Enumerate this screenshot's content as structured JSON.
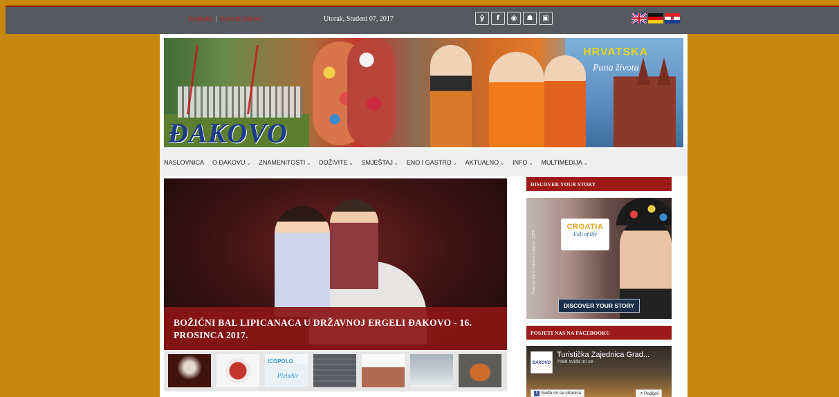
{
  "topbar": {
    "link_contact": "Kontakti",
    "separator": "|",
    "link_useful": "Korisni linkovi",
    "date": "Utorak, Studeni 07, 2017",
    "social_icons": [
      "twitter-icon",
      "facebook-icon",
      "pinterest-icon",
      "youtube-icon",
      "instagram-icon"
    ],
    "social_glyphs": [
      "ẏ",
      "f",
      "◉",
      "☗",
      "▣"
    ],
    "flags": [
      "uk-flag",
      "de-flag",
      "hr-flag"
    ]
  },
  "banner": {
    "logo_text": "ĐAKOVO",
    "tourism_text": "HRVATSKA",
    "tourism_slogan": "Puna života"
  },
  "nav": {
    "items": [
      {
        "label": "NASLOVNICA",
        "dropdown": false
      },
      {
        "label": "O ĐAKOVU",
        "dropdown": true
      },
      {
        "label": "ZNAMENITOSTI",
        "dropdown": true
      },
      {
        "label": "DOŽIVITE",
        "dropdown": true
      },
      {
        "label": "SMJEŠTAJ",
        "dropdown": true
      },
      {
        "label": "ENO I GASTRO",
        "dropdown": true
      },
      {
        "label": "AKTUALNO",
        "dropdown": true
      },
      {
        "label": "INFO",
        "dropdown": true
      },
      {
        "label": "MULTIMEDIJA",
        "dropdown": true
      }
    ],
    "chevron": "⌄"
  },
  "hero": {
    "caption": "BOŽIĆNI BAL LIPICANACA U DRŽAVNOJ ERGELI ĐAKOVO - 16. PROSINCA 2017."
  },
  "thumbs": {
    "t3_title": "ICOPOLO",
    "t3_sub": "PleinAir"
  },
  "sidebar": {
    "discover_heading": "DISCOVER YOUR STORY",
    "ad_brand": "CROATIA",
    "ad_slogan": "Full of life",
    "ad_photo_credit": "Photo by: Damir Fabijanić | Source: CNTB",
    "ad_button": "DISCOVER YOUR STORY",
    "facebook_heading": "POSJETI NAS NA FACEBOOKU",
    "fb_page_name": "Turistička Zajednica Grad...",
    "fb_likes": "7588 sviđa mi se",
    "fb_logo": "ĐAKOVO",
    "fb_like_button": "Sviđa mi se stranica",
    "fb_share_button": "Podijeli"
  },
  "colors": {
    "background": "#c8870f",
    "topbar": "#55595e",
    "accent_red": "#9e1919",
    "nav_bg": "#efefef"
  }
}
